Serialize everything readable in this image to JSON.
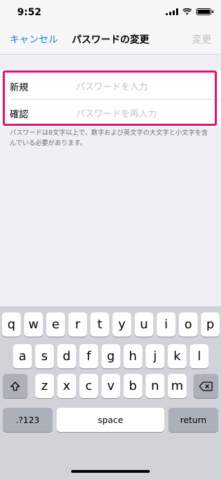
{
  "status": {
    "time": "9:52"
  },
  "nav": {
    "cancel": "キャンセル",
    "title": "パスワードの変更",
    "done": "変更"
  },
  "form": {
    "rows": [
      {
        "label": "新規",
        "placeholder": "パスワードを入力"
      },
      {
        "label": "確認",
        "placeholder": "パスワードを再入力"
      }
    ],
    "helper": "パスワードは8文字以上で、数字および英文字の大文字と小文字を含んでいる必要があります。"
  },
  "highlight_color": "#e4116f",
  "accent_color": "#1a7cf1",
  "keyboard": {
    "row1": [
      "q",
      "w",
      "e",
      "r",
      "t",
      "y",
      "u",
      "i",
      "o",
      "p"
    ],
    "row2": [
      "a",
      "s",
      "d",
      "f",
      "g",
      "h",
      "j",
      "k",
      "l"
    ],
    "row3": [
      "z",
      "x",
      "c",
      "v",
      "b",
      "n",
      "m"
    ],
    "shift_icon": "shift-icon",
    "delete_icon": "delete-icon",
    "numbers": ".?123",
    "space": "space",
    "return": "return"
  }
}
